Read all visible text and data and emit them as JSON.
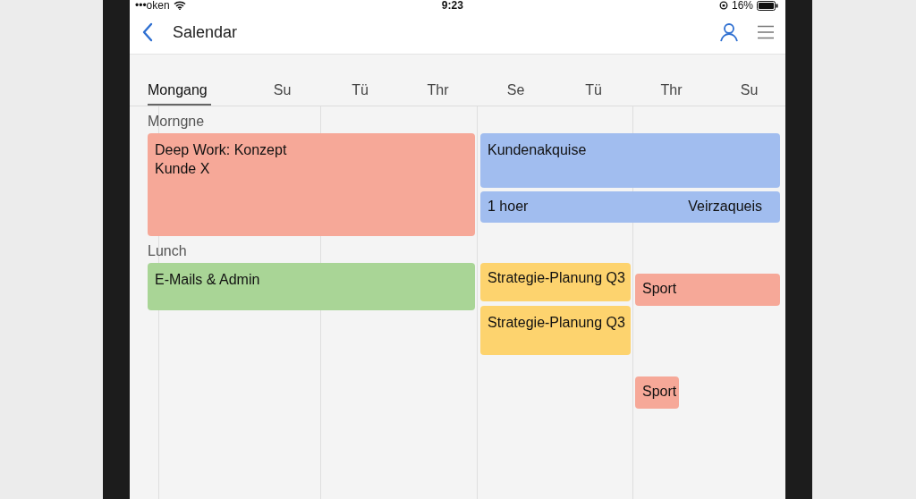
{
  "status_bar": {
    "carrier": "•••oken",
    "time": "9:23",
    "battery": "16%"
  },
  "nav": {
    "title": "Salendar"
  },
  "day_headers": [
    {
      "label": "Mongang",
      "selected": true
    },
    {
      "label": "Su",
      "selected": false
    },
    {
      "label": "Tü",
      "selected": false
    },
    {
      "label": "Thr",
      "selected": false
    },
    {
      "label": "Se",
      "selected": false
    },
    {
      "label": "Tü",
      "selected": false
    },
    {
      "label": "Thr",
      "selected": false
    },
    {
      "label": "Su",
      "selected": false
    }
  ],
  "sections": [
    "Morngne",
    "Lunch"
  ],
  "events": [
    {
      "lines": [
        "Deep Work: Konzept",
        "Kunde X"
      ],
      "color": "#f6a898"
    },
    {
      "lines": [
        "Kundenakquise"
      ],
      "color": "#a1bdef"
    },
    {
      "lines": [
        "1 hoer"
      ],
      "trailing": "Veirzaqueis",
      "color": "#a1bdef"
    },
    {
      "lines": [
        "E-Mails & Admin"
      ],
      "color": "#a9d596"
    },
    {
      "lines": [
        "Strategie-Planung Q3"
      ],
      "color": "#fdd36e"
    },
    {
      "lines": [
        "Strategie-Planung Q3"
      ],
      "color": "#fdd36e"
    },
    {
      "lines": [
        "Sport"
      ],
      "color": "#f6a898"
    },
    {
      "lines": [
        "Sport"
      ],
      "color": "#f6a898"
    }
  ]
}
